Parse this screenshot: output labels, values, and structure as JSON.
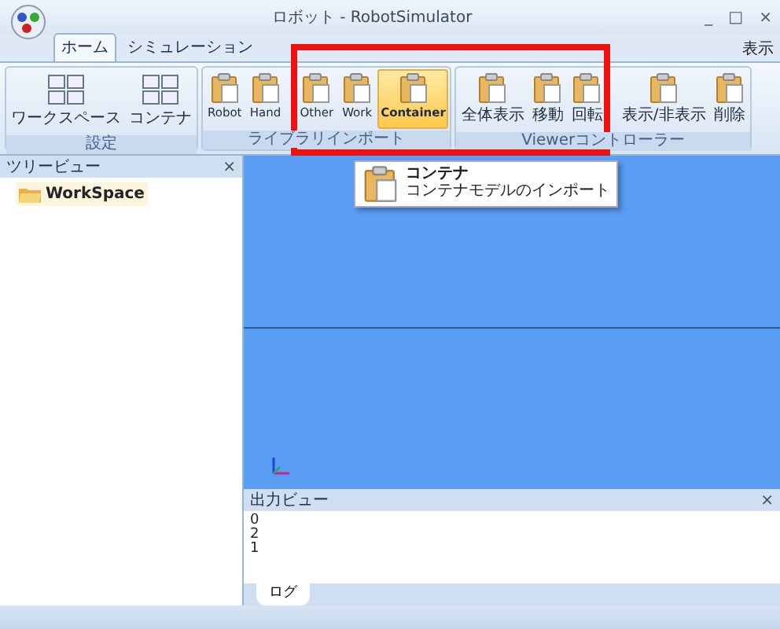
{
  "window": {
    "title": "ロボット - RobotSimulator",
    "controls": [
      "_",
      "□",
      "×"
    ]
  },
  "tabs": [
    {
      "label": "ホーム",
      "selected": true
    },
    {
      "label": "シミュレーション",
      "selected": false
    }
  ],
  "right_menu": {
    "label": "表示"
  },
  "ribbon_groups": [
    {
      "label": "設定",
      "buttons": [
        {
          "label": "ワークスペース",
          "selected": false
        },
        {
          "label": "コンテナ",
          "selected": false
        }
      ]
    },
    {
      "label": "ライブラリインポート",
      "buttons": [
        {
          "label": "Robot",
          "selected": false
        },
        {
          "label": "Hand",
          "selected": false
        },
        {
          "label": "Other",
          "selected": false
        },
        {
          "label": "Work",
          "selected": false
        },
        {
          "label": "Container",
          "selected": true
        }
      ]
    },
    {
      "label": "Viewerコントローラー",
      "buttons": [
        {
          "label": "全体表示",
          "selected": false
        },
        {
          "label": "移動",
          "selected": false
        },
        {
          "label": "回転",
          "selected": false
        },
        {
          "label": "表示/非表示",
          "selected": false
        },
        {
          "label": "削除",
          "selected": false
        }
      ]
    }
  ],
  "tooltip": {
    "title": "コンテナ",
    "description": "コンテナモデルのインポート"
  },
  "tree_view": {
    "title": "ツリービュー",
    "close": "×",
    "items": [
      {
        "label": "WorkSpace",
        "selected": true
      }
    ]
  },
  "output_view": {
    "title": "出力ビュー",
    "close": "×",
    "lines": [
      "0",
      "2",
      "1"
    ],
    "tabs": [
      {
        "label": "ログ",
        "selected": true
      }
    ]
  },
  "highlight": {
    "kind": "annotation"
  }
}
